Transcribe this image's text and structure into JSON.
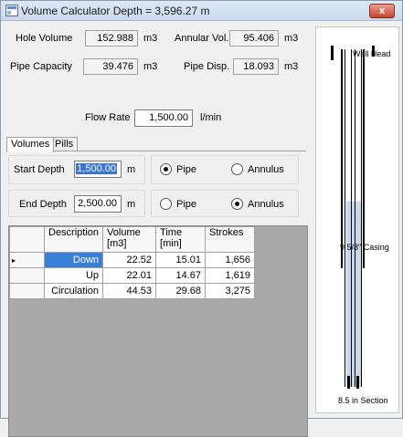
{
  "window": {
    "title": "Volume Calculator Depth = 3,596.27 m",
    "close_label": "x"
  },
  "summary": {
    "hole_volume_label": "Hole Volume",
    "hole_volume_value": "152.988",
    "hole_volume_unit": "m3",
    "annular_vol_label": "Annular Vol.",
    "annular_vol_value": "95.406",
    "annular_vol_unit": "m3",
    "pipe_capacity_label": "Pipe Capacity",
    "pipe_capacity_value": "39.476",
    "pipe_capacity_unit": "m3",
    "pipe_disp_label": "Pipe Disp.",
    "pipe_disp_value": "18.093",
    "pipe_disp_unit": "m3",
    "flow_rate_label": "Flow Rate",
    "flow_rate_value": "1,500.00",
    "flow_rate_unit": "l/min"
  },
  "tabs": [
    {
      "label": "Volumes",
      "active": true
    },
    {
      "label": "Pills",
      "active": false
    }
  ],
  "volumes": {
    "start_depth_label": "Start Depth",
    "start_depth_value": "1,500.00",
    "start_depth_unit": "m",
    "end_depth_label": "End Depth",
    "end_depth_value": "2,500.00",
    "end_depth_unit": "m",
    "start_options": [
      {
        "label": "Pipe",
        "checked": true
      },
      {
        "label": "Annulus",
        "checked": false
      }
    ],
    "end_options": [
      {
        "label": "Pipe",
        "checked": false
      },
      {
        "label": "Annulus",
        "checked": true
      }
    ]
  },
  "grid": {
    "columns": [
      "Description",
      "Volume\n[m3]",
      "Time\n[min]",
      "Strokes"
    ],
    "current_row_marker": "▸",
    "rows": [
      {
        "description": "Down",
        "volume": "22.52",
        "time": "15.01",
        "strokes": "1,656"
      },
      {
        "description": "Up",
        "volume": "22.01",
        "time": "14.67",
        "strokes": "1,619"
      },
      {
        "description": "Circulation",
        "volume": "44.53",
        "time": "29.68",
        "strokes": "3,275"
      }
    ]
  },
  "wellbore": {
    "well_head_label": "Well Head",
    "casing_label": "9 5/8\" Casing",
    "section_label": "8.5 in Section",
    "fluid_fill_fraction": 0.55,
    "colors": {
      "fluid": "#c9d7ec",
      "pipe": "#000000"
    }
  }
}
